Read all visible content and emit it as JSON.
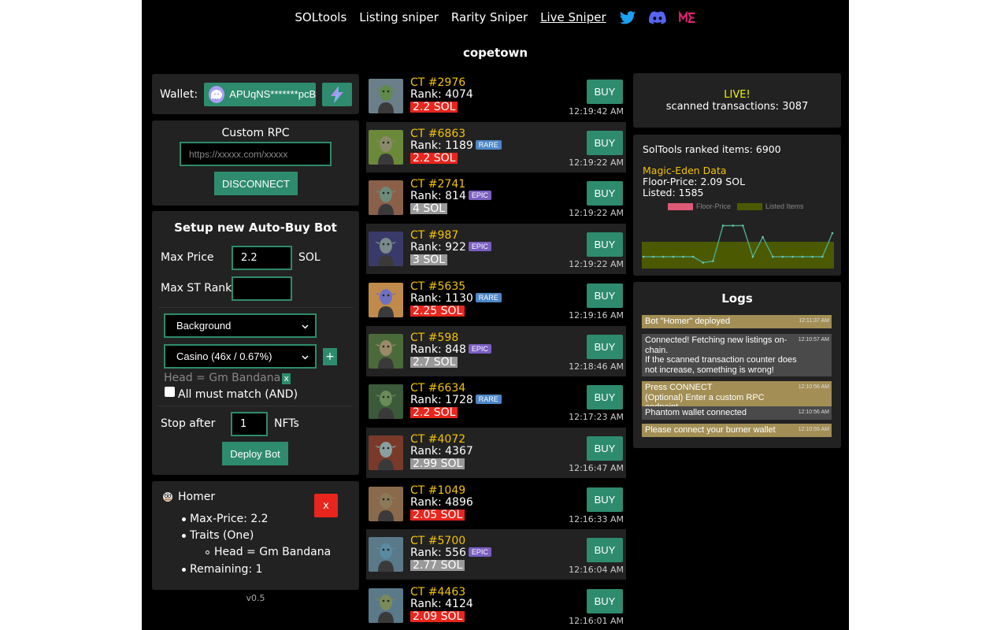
{
  "nav": {
    "links": [
      "SOLtools",
      "Listing sniper",
      "Rarity Sniper",
      "Live Sniper"
    ],
    "icons": [
      "twitter-icon",
      "discord-icon",
      "magic-eden-icon"
    ],
    "colors": {
      "twitter": "#1da1f2",
      "discord": "#5865f2",
      "magic_eden": "#e42575"
    }
  },
  "collection": "copetown",
  "wallet": {
    "label": "Wallet:",
    "address": "APUqNS*******pcB"
  },
  "rpc": {
    "title": "Custom RPC",
    "placeholder": "https://xxxxx.com/xxxxx",
    "button": "DISCONNECT"
  },
  "bot": {
    "title": "Setup new Auto-Buy Bot",
    "max_price_label": "Max Price",
    "max_price_value": "2.2",
    "max_price_unit": "SOL",
    "max_rank_label": "Max ST Rank",
    "max_rank_value": "",
    "trait_type": "Background",
    "trait_value": "Casino (46x / 0.67%)",
    "plus": "+",
    "selected_trait": "Head = Gm Bandana",
    "remove": "x",
    "all_must_match": "All must match (AND)",
    "stop_after_label": "Stop after",
    "stop_after_value": "1",
    "stop_after_unit": "NFTs",
    "deploy_button": "Deploy Bot"
  },
  "homer": {
    "name": "Homer",
    "max_price": "Max-Price: 2.2",
    "traits": "Traits (One)",
    "trait": "Head = Gm Bandana",
    "remaining": "Remaining: 1",
    "close": "x"
  },
  "version": "v0.5",
  "listings": [
    {
      "name": "CT #2976",
      "rank": "Rank: 4074",
      "badge": "",
      "price": "2.2 SOL",
      "price_color": "#e8261d",
      "time": "12:19:42 AM",
      "buy": "BUY",
      "skin": "#5f8a4a",
      "bg": "#6b7f8a"
    },
    {
      "name": "CT #6863",
      "rank": "Rank: 1189",
      "badge": "RARE",
      "price": "2.2 SOL",
      "price_color": "#e8261d",
      "time": "12:19:22 AM",
      "buy": "BUY",
      "skin": "#8a8a6a",
      "bg": "#6a8a3a"
    },
    {
      "name": "CT #2741",
      "rank": "Rank: 814",
      "badge": "EPIC",
      "price": "4 SOL",
      "price_color": "#999999",
      "time": "12:19:22 AM",
      "buy": "BUY",
      "skin": "#6e8a7a",
      "bg": "#8a6048"
    },
    {
      "name": "CT #987",
      "rank": "Rank: 922",
      "badge": "EPIC",
      "price": "3 SOL",
      "price_color": "#999999",
      "time": "12:19:22 AM",
      "buy": "BUY",
      "skin": "#7a8a8a",
      "bg": "#3a3a6a"
    },
    {
      "name": "CT #5635",
      "rank": "Rank: 1130",
      "badge": "RARE",
      "price": "2.25 SOL",
      "price_color": "#e8261d",
      "time": "12:19:16 AM",
      "buy": "BUY",
      "skin": "#7070c0",
      "bg": "#c08a4a"
    },
    {
      "name": "CT #598",
      "rank": "Rank: 848",
      "badge": "EPIC",
      "price": "2.7 SOL",
      "price_color": "#999999",
      "time": "12:18:46 AM",
      "buy": "BUY",
      "skin": "#9a8a6a",
      "bg": "#4a6a3a"
    },
    {
      "name": "CT #6634",
      "rank": "Rank: 1728",
      "badge": "RARE",
      "price": "2.2 SOL",
      "price_color": "#e8261d",
      "time": "12:17:23 AM",
      "buy": "BUY",
      "skin": "#6a8a5a",
      "bg": "#3a5a3a"
    },
    {
      "name": "CT #4072",
      "rank": "Rank: 4367",
      "badge": "",
      "price": "2.99 SOL",
      "price_color": "#999999",
      "time": "12:16:47 AM",
      "buy": "BUY",
      "skin": "#8aa0a0",
      "bg": "#7a3a2a"
    },
    {
      "name": "CT #1049",
      "rank": "Rank: 4896",
      "badge": "",
      "price": "2.05 SOL",
      "price_color": "#e8261d",
      "time": "12:16:33 AM",
      "buy": "BUY",
      "skin": "#8a7a5a",
      "bg": "#8a6a4a"
    },
    {
      "name": "CT #5700",
      "rank": "Rank: 556",
      "badge": "EPIC",
      "price": "2.77 SOL",
      "price_color": "#999999",
      "time": "12:16:04 AM",
      "buy": "BUY",
      "skin": "#5a8aa0",
      "bg": "#5a7a8a"
    },
    {
      "name": "CT #4463",
      "rank": "Rank: 4124",
      "badge": "",
      "price": "2.09 SOL",
      "price_color": "#e8261d",
      "time": "12:16:01 AM",
      "buy": "BUY",
      "skin": "#7a8a5a",
      "bg": "#5a7a8a"
    }
  ],
  "badge_colors": {
    "RARE": "#4d86c6",
    "EPIC": "#7a5fc0"
  },
  "live": {
    "status": "LIVE!",
    "scanned": "scanned transactions: 3087"
  },
  "stats": {
    "ranked": "SolTools ranked items: 6900",
    "me_title": "Magic-Eden Data",
    "floor": "Floor-Price: 2.09 SOL",
    "listed": "Listed: 1585"
  },
  "chart_data": {
    "type": "line",
    "legend": [
      "Floor-Price",
      "Listed Items"
    ],
    "legend_placement": "top",
    "series": [
      {
        "name": "Floor-Price",
        "color": "#ff6384",
        "values": [
          2.2,
          2.2,
          2.2,
          2.2,
          2.2,
          2.2,
          2.05,
          2.09,
          2.99,
          2.99,
          2.99,
          2.2,
          2.7,
          2.2,
          2.2,
          2.2,
          2.2,
          2.2,
          2.2,
          2.8
        ]
      },
      {
        "name": "Listed Items",
        "color": "#4b5a00",
        "values": [
          1585,
          1585,
          1585,
          1585,
          1585,
          1585,
          1585,
          1585,
          1585,
          1585,
          1585,
          1585,
          1585,
          1585,
          1585,
          1585,
          1585,
          1585,
          1585,
          1585
        ]
      }
    ],
    "ylim": [
      1.9,
      3.3
    ]
  },
  "logs": {
    "title": "Logs",
    "entries": [
      {
        "text": "Bot \"Homer\" deployed",
        "time": "12:11:37 AM",
        "color": "#a38f55"
      },
      {
        "text": "Connected! Fetching new listings on-chain.\nIf the scanned transaction counter does not increase, something is wrong!",
        "time": "12:10:57 AM",
        "color": "#4a4a4a"
      },
      {
        "text": "Press CONNECT\n(Optional) Enter a custom RPC endpoint",
        "time": "12:10:56 AM",
        "color": "#a38f55"
      },
      {
        "text": "Phantom wallet connected",
        "time": "12:10:56 AM",
        "color": "#4a4a4a"
      },
      {
        "text": "Please connect your burner wallet",
        "time": "12:10:55 AM",
        "color": "#a38f55"
      }
    ]
  }
}
